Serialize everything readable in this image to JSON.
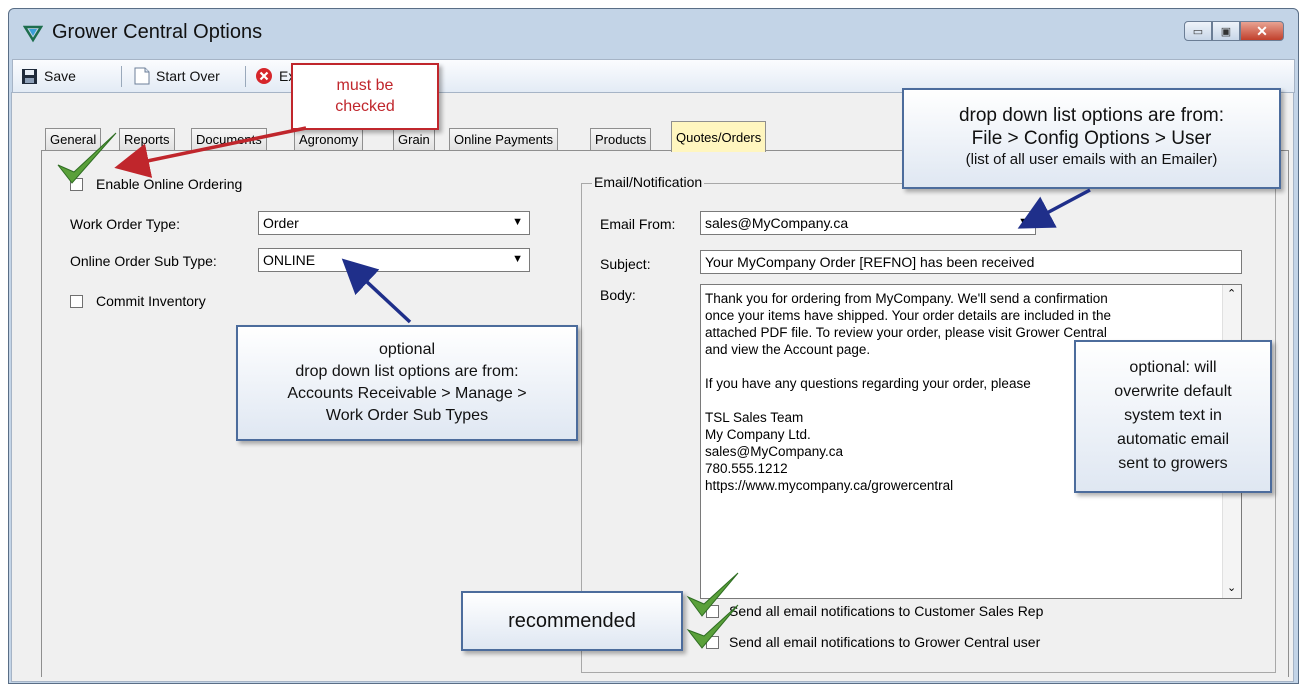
{
  "window": {
    "title": "Grower Central Options",
    "minimize_glyph": "▭",
    "restore_glyph": "▣",
    "close_glyph": "✕"
  },
  "toolbar": {
    "save_label": "Save",
    "start_over_label": "Start Over",
    "exit_label": "Exit"
  },
  "tabs": [
    {
      "label": "General"
    },
    {
      "label": "Reports"
    },
    {
      "label": "Documents"
    },
    {
      "label": "Agronomy"
    },
    {
      "label": "Grain"
    },
    {
      "label": "Online Payments"
    },
    {
      "label": "Products"
    },
    {
      "label": "Quotes/Orders"
    }
  ],
  "left": {
    "enable_online_ordering": "Enable Online Ordering",
    "work_order_type_label": "Work Order Type:",
    "work_order_type_value": "Order",
    "sub_type_label": "Online Order Sub Type:",
    "sub_type_value": "ONLINE",
    "commit_inventory": "Commit Inventory"
  },
  "email": {
    "group_title": "Email/Notification",
    "from_label": "Email From:",
    "from_value": "sales@MyCompany.ca",
    "subject_label": "Subject:",
    "subject_value": "Your MyCompany Order [REFNO] has been received",
    "body_label": "Body:",
    "body_lines": [
      "Thank you for ordering from MyCompany. We'll send a confirmation",
      "once your items have shipped. Your order details are included in the",
      "attached PDF file. To review your order, please visit Grower Central",
      "and view the Account page.",
      "",
      "If you have any questions regarding your order, please",
      "",
      "TSL Sales Team",
      "My Company Ltd.",
      "sales@MyCompany.ca",
      "780.555.1212",
      "https://www.mycompany.ca/growercentral"
    ],
    "notify_sales_rep": "Send all email notifications to Customer Sales Rep",
    "notify_grower_user": "Send all email notifications to Grower Central user"
  },
  "callouts": {
    "must_be_checked": [
      "must be",
      "checked"
    ],
    "dropdown_user": [
      "drop down list options are from:",
      "File > Config Options > User",
      "(list of all user emails with an Emailer)"
    ],
    "optional_subtype": [
      "optional",
      "drop down list options are from:",
      "Accounts Receivable > Manage >",
      "Work Order Sub Types"
    ],
    "optional_body": [
      "optional: will",
      "overwrite default",
      "system text in",
      "automatic email",
      "sent to growers"
    ],
    "recommended": "recommended"
  },
  "colors": {
    "active_tab": "#fff6bf",
    "callout_border": "#4c6c9c",
    "red_callout": "#c0262c",
    "checkmark_green": "#5aa03a"
  }
}
